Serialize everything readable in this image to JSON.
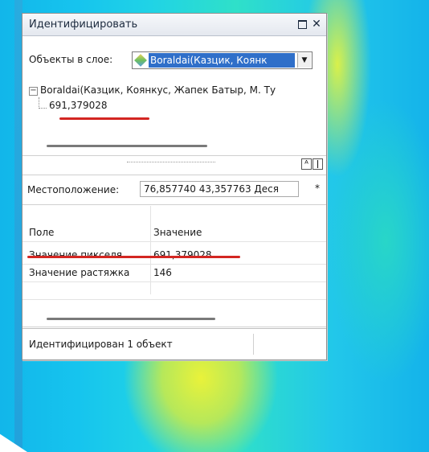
{
  "window": {
    "title": "Идентифицировать",
    "maximize_icon": "maximize-icon",
    "close_glyph": "✕"
  },
  "layer_select": {
    "label": "Объекты в слое:",
    "value": "Boraldai(Казцик, Коянк",
    "icon": "raster-layer-icon"
  },
  "tree": {
    "root_label": "Boraldai(Казцик, Коянкус, Жапек Батыр, М. Ту",
    "child_value": "691,379028",
    "expander_symbol": "−"
  },
  "location": {
    "label": "Местоположение:",
    "value": "76,857740  43,357763 Деся",
    "units_button": "*"
  },
  "grid": {
    "headers": [
      "Поле",
      "Значение"
    ],
    "rows": [
      [
        "Значение пикселя",
        "691,379028"
      ],
      [
        "Значение растяжка",
        "146"
      ]
    ]
  },
  "status": {
    "text": "Идентифицирован 1 объект"
  },
  "colors": {
    "annotation_red": "#d32622",
    "selection_blue": "#2f6fc9"
  }
}
